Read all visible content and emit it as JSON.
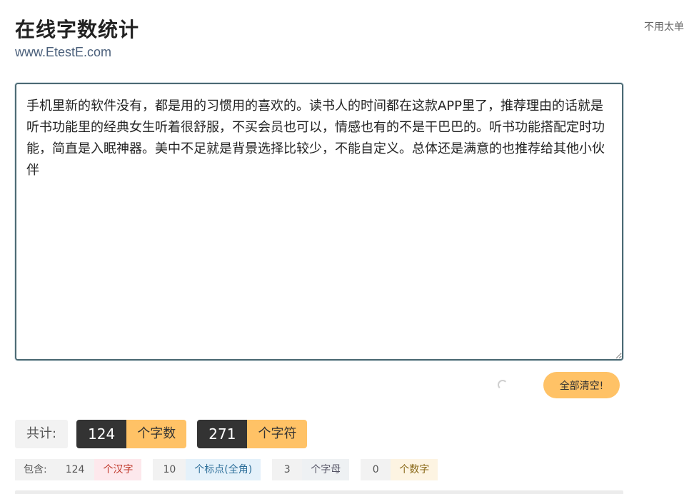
{
  "header": {
    "title": "在线字数统计",
    "subtitle": "www.EtestE.com",
    "top_note": "不用太单"
  },
  "editor": {
    "text": "手机里新的软件没有，都是用的习惯用的喜欢的。读书人的时间都在这款APP里了，推荐理由的话就是听书功能里的经典女生听着很舒服，不买会员也可以，情感也有的不是干巴巴的。听书功能搭配定时功能，简直是入眠神器。美中不足就是背景选择比较少，不能自定义。总体还是满意的也推荐给其他小伙伴"
  },
  "actions": {
    "clear_label": "全部清空!",
    "loading_icon": "spinner-icon"
  },
  "summary": {
    "label": "共计:",
    "words_count": "124",
    "words_unit": "个字数",
    "chars_count": "271",
    "chars_unit": "个字符"
  },
  "detail": {
    "label": "包含:",
    "han_count": "124",
    "han_unit": "个汉字",
    "punct_count": "10",
    "punct_unit": "个标点(全角)",
    "letter_count": "3",
    "letter_unit": "个字母",
    "digit_count": "0",
    "digit_unit": "个数字"
  },
  "colors": {
    "accent": "#ffc266",
    "dark_badge": "#333333",
    "border": "#4c6a74"
  }
}
